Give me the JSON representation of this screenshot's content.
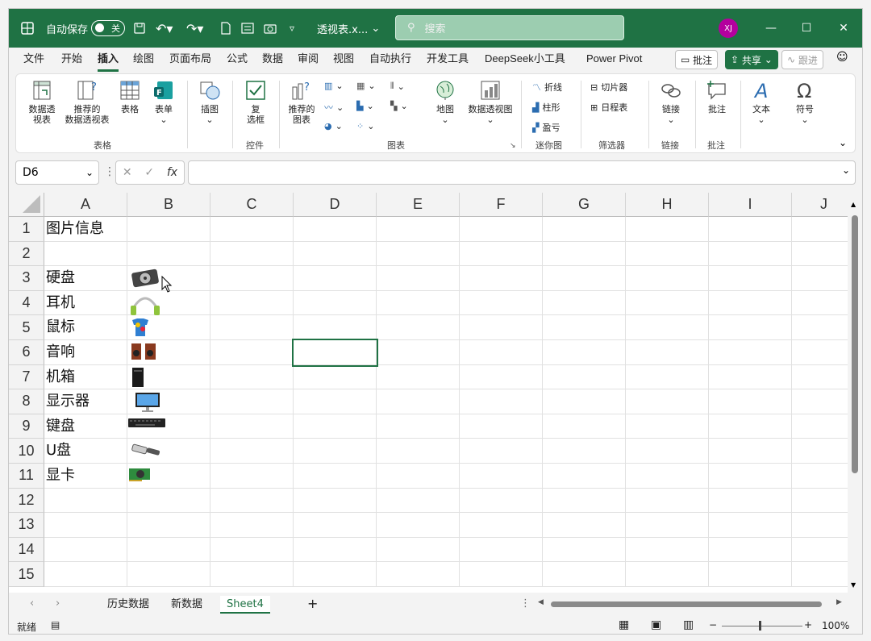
{
  "titlebar": {
    "autosave_label": "自动保存",
    "autosave_state": "关",
    "filename": "透视表.x...",
    "search_placeholder": "搜索",
    "user_initials": "XJ",
    "minimize": "—",
    "maximize": "☐",
    "close": "✕"
  },
  "menu": {
    "items": [
      "文件",
      "开始",
      "插入",
      "绘图",
      "页面布局",
      "公式",
      "数据",
      "审阅",
      "视图",
      "自动执行",
      "开发工具",
      "DeepSeek小工具",
      "Power Pivot"
    ],
    "comment_btn": "批注",
    "share_btn": "共享",
    "catchup_btn": "跟进"
  },
  "ribbon": {
    "pivot_table": "数据透\n视表",
    "recommended_pivot": "推荐的\n数据透视表",
    "table": "表格",
    "forms": "表单",
    "group_tables": "表格",
    "illustrations": "插图",
    "checkbox": "复\n选框",
    "group_controls": "控件",
    "recommended_charts": "推荐的\n图表",
    "maps": "地图",
    "pivot_chart": "数据透视图",
    "group_charts": "图表",
    "spark_line": "折线",
    "spark_column": "柱形",
    "spark_winloss": "盈亏",
    "group_sparklines": "迷你图",
    "slicer": "切片器",
    "timeline": "日程表",
    "group_filters": "筛选器",
    "link": "链接",
    "group_links": "链接",
    "comment": "批注",
    "group_comments": "批注",
    "text": "文本",
    "symbols": "符号"
  },
  "formula": {
    "namebox": "D6",
    "fx": "fx",
    "content": ""
  },
  "grid": {
    "columns": [
      "A",
      "B",
      "C",
      "D",
      "E",
      "F",
      "G",
      "H",
      "I",
      "J"
    ],
    "rows": [
      "1",
      "2",
      "3",
      "4",
      "5",
      "6",
      "7",
      "8",
      "9",
      "10",
      "11",
      "12",
      "13",
      "14",
      "15"
    ],
    "col_a": [
      "图片信息",
      "",
      "硬盘",
      "耳机",
      "鼠标",
      "音响",
      "机箱",
      "显示器",
      "键盘",
      "U盘",
      "显卡",
      "",
      "",
      "",
      ""
    ]
  },
  "sheets": {
    "tabs": [
      "历史数据",
      "新数据",
      "Sheet4"
    ],
    "add": "+"
  },
  "status": {
    "ready": "就绪",
    "zoom": "100%",
    "minus": "−",
    "plus": "+"
  }
}
